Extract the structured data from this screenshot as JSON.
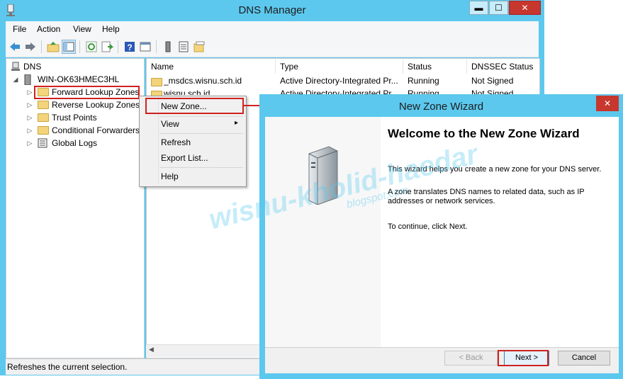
{
  "main_window": {
    "title": "DNS Manager",
    "controls": {
      "minimize": "▬",
      "maximize": "☐",
      "close": "✕"
    }
  },
  "menu": [
    "File",
    "Action",
    "View",
    "Help"
  ],
  "toolbar_icons": [
    "back-arrow-icon",
    "forward-arrow-icon",
    "up-folder-icon",
    "console-tree-icon",
    "refresh-icon",
    "export-list-icon",
    "help-icon",
    "properties-icon",
    "server-icon",
    "list-icon",
    "folder-icon"
  ],
  "tree": {
    "root": "DNS",
    "server": "WIN-OK63HMEC3HL",
    "items": [
      "Forward Lookup Zones",
      "Reverse Lookup Zones",
      "Trust Points",
      "Conditional Forwarders",
      "Global Logs"
    ]
  },
  "list": {
    "columns": [
      "Name",
      "Type",
      "Status",
      "DNSSEC Status"
    ],
    "rows": [
      {
        "name": "_msdcs.wisnu.sch.id",
        "type": "Active Directory-Integrated Pr...",
        "status": "Running",
        "dnssec": "Not Signed"
      },
      {
        "name": "wisnu.sch.id",
        "type": "Active Directory-Integrated Pr...",
        "status": "Running",
        "dnssec": "Not Signed"
      }
    ]
  },
  "context_menu": {
    "items": [
      "New Zone...",
      "View",
      "Refresh",
      "Export List...",
      "Help"
    ],
    "submenu_arrow": "▸"
  },
  "status_bar": "Refreshes the current selection.",
  "wizard": {
    "title": "New Zone Wizard",
    "close": "✕",
    "heading": "Welcome to the New Zone Wizard",
    "paragraphs": [
      "This wizard helps you create a new zone for your DNS server.",
      "A zone translates DNS names to related data, such as IP addresses or network services.",
      "To continue, click Next."
    ],
    "buttons": {
      "back": "< Back",
      "next": "Next >",
      "cancel": "Cancel"
    }
  },
  "watermark": {
    "main": "wisnu-kholid-haedar",
    "sub": "blogspot.com"
  },
  "colors": {
    "title_bar": "#5cc8ee",
    "close": "#c7372e",
    "highlight_box": "#d02121"
  }
}
